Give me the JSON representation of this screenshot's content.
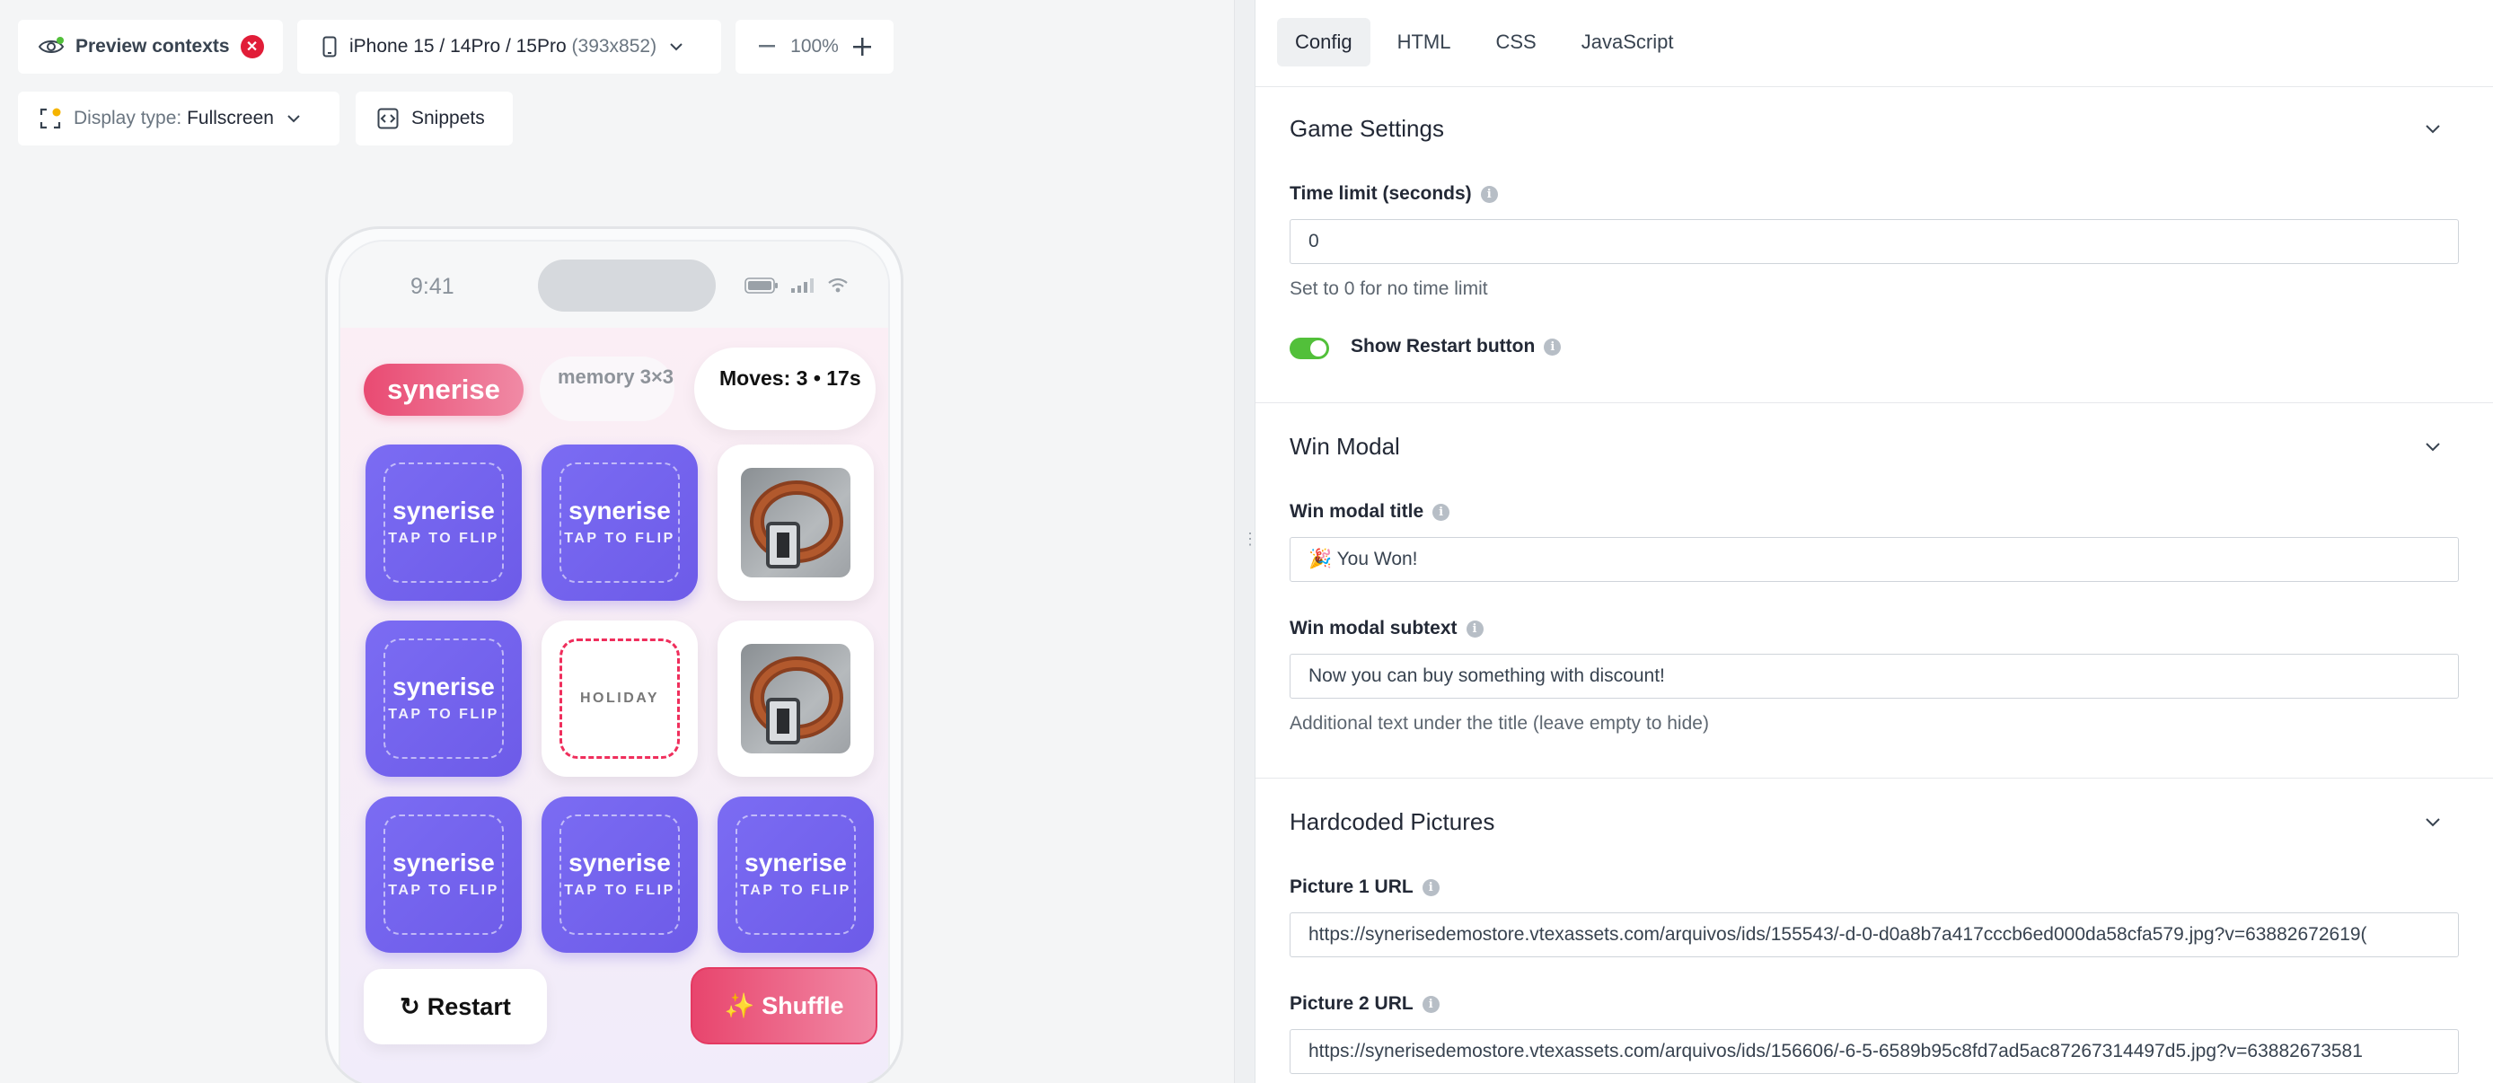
{
  "toolbar": {
    "preview_contexts": "Preview contexts",
    "device_name": "iPhone 15 / 14Pro / 15Pro",
    "device_size": "(393x852)",
    "zoom": "100%",
    "display_type_label": "Display type:",
    "display_type_value": "Fullscreen",
    "snippets": "Snippets"
  },
  "phone": {
    "time": "9:41",
    "brand_pill": "synerise",
    "mode_pill": "memory 3×3",
    "moves": "Moves: 3 • 17s",
    "card_back_title": "synerise",
    "card_back_sub": "TAP TO FLIP",
    "holiday": "HOLIDAY",
    "restart": "Restart",
    "shuffle": "Shuffle",
    "restart_icon": "↻",
    "shuffle_icon": "✨"
  },
  "tabs": [
    "Config",
    "HTML",
    "CSS",
    "JavaScript"
  ],
  "sections": {
    "game_settings": {
      "title": "Game Settings",
      "time_limit_label": "Time limit (seconds)",
      "time_limit_value": "0",
      "time_limit_help": "Set to 0 for no time limit",
      "show_restart_label": "Show Restart button"
    },
    "win_modal": {
      "title": "Win Modal",
      "modal_title_label": "Win modal title",
      "modal_title_value": "🎉 You Won!",
      "modal_subtext_label": "Win modal subtext",
      "modal_subtext_value": "Now you can buy something with discount!",
      "modal_subtext_help": "Additional text under the title (leave empty to hide)"
    },
    "hardcoded_pictures": {
      "title": "Hardcoded Pictures",
      "picture1_label": "Picture 1 URL",
      "picture1_value": "https://synerisedemostore.vtexassets.com/arquivos/ids/155543/-d-0-d0a8b7a417cccb6ed000da58cfa579.jpg?v=63882672619(",
      "picture2_label": "Picture 2 URL",
      "picture2_value": "https://synerisedemostore.vtexassets.com/arquivos/ids/156606/-6-5-6589b95c8fd7ad5ac87267314497d5.jpg?v=63882673581"
    }
  },
  "colors": {
    "accent_pink": "#e94a72",
    "card_purple": "#7b6cf3",
    "toggle_green": "#52c03a",
    "error_red": "#e11d38"
  }
}
